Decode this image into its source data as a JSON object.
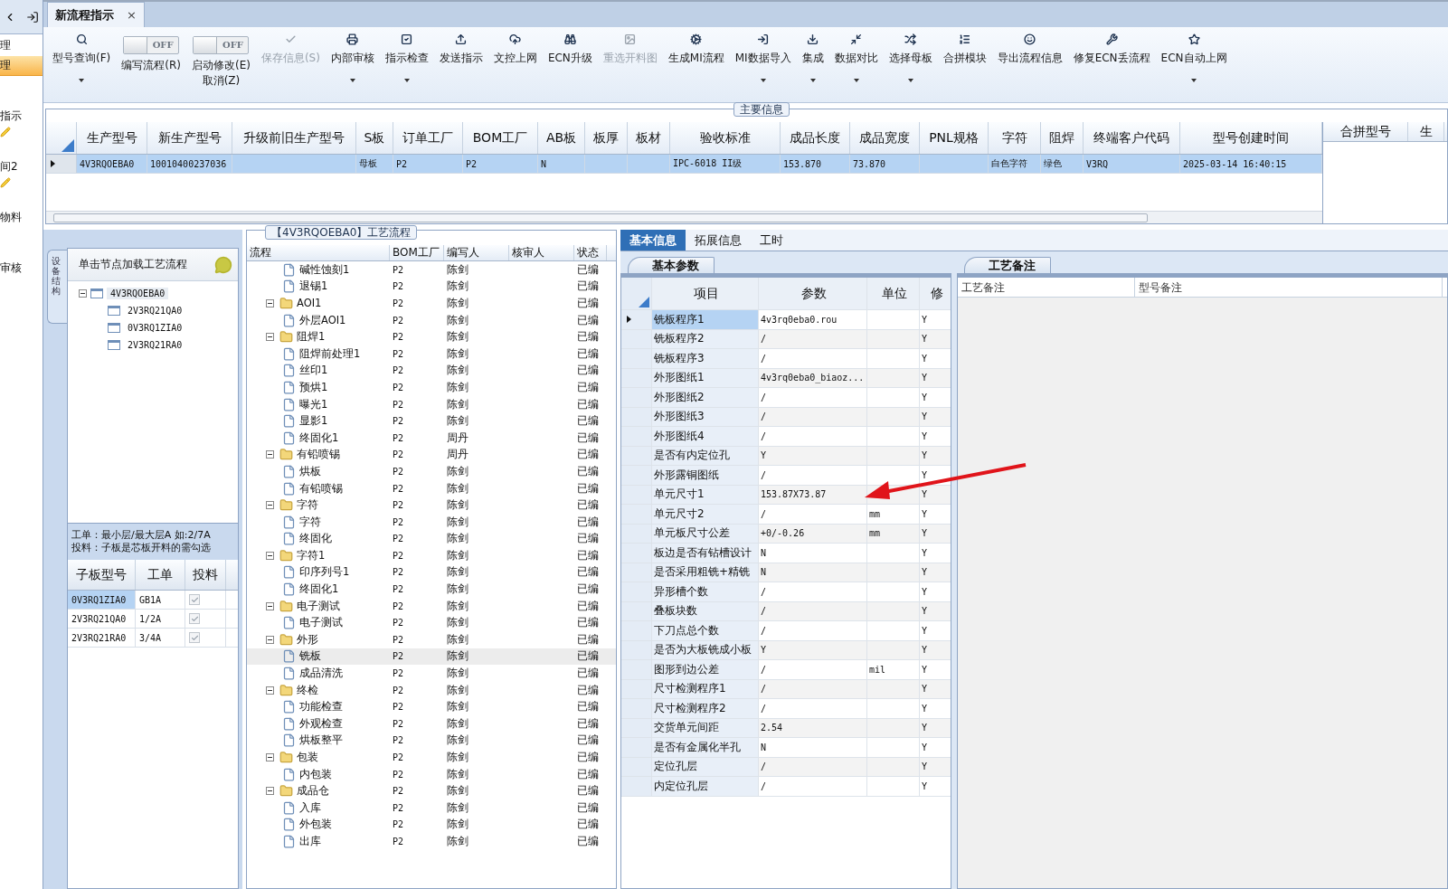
{
  "sidebar": {
    "items": [
      {
        "label": "理",
        "kind": "plain",
        "selected": false
      },
      {
        "label": "理",
        "kind": "plain",
        "selected": true
      },
      {
        "label": "指示",
        "kind": "plain",
        "selected": false
      },
      {
        "label": "间2",
        "kind": "tool",
        "selected": false
      },
      {
        "label": "物料",
        "kind": "tool",
        "selected": false
      },
      {
        "label": "审核",
        "kind": "plain",
        "selected": false
      }
    ]
  },
  "document_tab": {
    "title": "新流程指示",
    "close": "×"
  },
  "toolbar": [
    {
      "kind": "button",
      "label": "型号查询(F)",
      "dropdown": true,
      "disabled": false
    },
    {
      "kind": "toggle",
      "label": "编写流程(R)",
      "switch_text": "OFF",
      "on": false
    },
    {
      "kind": "toggle",
      "label": "启动修改(E)",
      "sublabel": "取消(Z)",
      "switch_text": "OFF",
      "on": false
    },
    {
      "kind": "button",
      "label": "保存信息(S)",
      "dropdown": false,
      "disabled": true
    },
    {
      "kind": "button",
      "label": "内部审核",
      "dropdown": true,
      "disabled": false
    },
    {
      "kind": "button",
      "label": "指示检查",
      "dropdown": true,
      "disabled": false
    },
    {
      "kind": "button",
      "label": "发送指示",
      "dropdown": false,
      "disabled": false
    },
    {
      "kind": "button",
      "label": "文控上网",
      "dropdown": false,
      "disabled": false
    },
    {
      "kind": "button",
      "label": "ECN升级",
      "dropdown": false,
      "disabled": false
    },
    {
      "kind": "button",
      "label": "重选开料图",
      "dropdown": false,
      "disabled": true
    },
    {
      "kind": "button",
      "label": "生成MI流程",
      "dropdown": false,
      "disabled": false
    },
    {
      "kind": "button",
      "label": "MI数据导入",
      "dropdown": true,
      "disabled": false
    },
    {
      "kind": "button",
      "label": "集成",
      "dropdown": true,
      "disabled": false
    },
    {
      "kind": "button",
      "label": "数据对比",
      "dropdown": true,
      "disabled": false
    },
    {
      "kind": "button",
      "label": "选择母板",
      "dropdown": true,
      "disabled": false
    },
    {
      "kind": "button",
      "label": "合拼模块",
      "dropdown": false,
      "disabled": false
    },
    {
      "kind": "button",
      "label": "导出流程信息",
      "dropdown": false,
      "disabled": false
    },
    {
      "kind": "button",
      "label": "修复ECN丢流程",
      "dropdown": false,
      "disabled": false
    },
    {
      "kind": "button",
      "label": "ECN自动上网",
      "dropdown": true,
      "disabled": false
    }
  ],
  "main_info": {
    "title": "主要信息",
    "columns": [
      "生产型号",
      "新生产型号",
      "升级前旧生产型号",
      "S板",
      "订单工厂",
      "BOM工厂",
      "AB板",
      "板厚",
      "板材",
      "验收标准",
      "成品长度",
      "成品宽度",
      "PNL规格",
      "字符",
      "阻焊",
      "终端客户代码",
      "型号创建时间"
    ],
    "rows": [
      {
        "selected": true,
        "cells": [
          "4V3RQOEBA0",
          "10010400237036",
          null,
          "母板",
          "P2",
          "P2",
          "N",
          null,
          null,
          "IPC-6018 II级",
          "153.870",
          "73.870",
          null,
          "白色字符",
          "绿色",
          "V3RQ",
          "2025-03-14 16:40:15"
        ]
      }
    ],
    "side_columns": [
      "合拼型号",
      "生"
    ]
  },
  "structure_panel": {
    "vertical_tab": "设备结构",
    "header": "单击节点加载工艺流程",
    "tree": [
      {
        "label": "4V3RQOEBA0",
        "selected": true,
        "expanded": true,
        "children": [
          {
            "label": "2V3RQ21QA0",
            "selected": false
          },
          {
            "label": "0V3RQ1ZIA0",
            "selected": false
          },
          {
            "label": "2V3RQ21RA0",
            "selected": false
          }
        ]
      }
    ],
    "notes": [
      "工单：最小层/最大层A 如:2/7A",
      "投料：子板是芯板开料的需勾选"
    ],
    "columns": [
      "子板型号",
      "工单",
      "投料"
    ],
    "rows": [
      {
        "board": "0V3RQ1ZIA0",
        "order": "GB1A",
        "checked": true,
        "selected": true
      },
      {
        "board": "2V3RQ21QA0",
        "order": "1/2A",
        "checked": true,
        "selected": false
      },
      {
        "board": "2V3RQ21RA0",
        "order": "3/4A",
        "checked": true,
        "selected": false
      }
    ]
  },
  "process_panel": {
    "title": "【4V3RQOEBA0】工艺流程",
    "columns": [
      "流程",
      "BOM工厂",
      "编写人",
      "核审人",
      "状态"
    ],
    "rows": [
      {
        "kind": "step",
        "label": "碱性蚀刻1",
        "bom": "P2",
        "writer": "陈剑",
        "status": "已编",
        "selected": false
      },
      {
        "kind": "step",
        "label": "退锡1",
        "bom": "P2",
        "writer": "陈剑",
        "status": "已编",
        "selected": false
      },
      {
        "kind": "group",
        "label": "AOI1",
        "bom": "P2",
        "writer": "陈剑",
        "status": "已编",
        "selected": false,
        "expanded": true,
        "children": [
          {
            "kind": "step",
            "label": "外层AOI1",
            "bom": "P2",
            "writer": "陈剑",
            "status": "已编",
            "selected": false
          }
        ]
      },
      {
        "kind": "group",
        "label": "阻焊1",
        "bom": "P2",
        "writer": "陈剑",
        "status": "已编",
        "selected": false,
        "expanded": true,
        "children": [
          {
            "kind": "step",
            "label": "阻焊前处理1",
            "bom": "P2",
            "writer": "陈剑",
            "status": "已编",
            "selected": false
          },
          {
            "kind": "step",
            "label": "丝印1",
            "bom": "P2",
            "writer": "陈剑",
            "status": "已编",
            "selected": false
          },
          {
            "kind": "step",
            "label": "预烘1",
            "bom": "P2",
            "writer": "陈剑",
            "status": "已编",
            "selected": false
          },
          {
            "kind": "step",
            "label": "曝光1",
            "bom": "P2",
            "writer": "陈剑",
            "status": "已编",
            "selected": false
          },
          {
            "kind": "step",
            "label": "显影1",
            "bom": "P2",
            "writer": "陈剑",
            "status": "已编",
            "selected": false
          },
          {
            "kind": "step",
            "label": "终固化1",
            "bom": "P2",
            "writer": "周丹",
            "status": "已编",
            "selected": false
          }
        ]
      },
      {
        "kind": "group",
        "label": "有铅喷锡",
        "bom": "P2",
        "writer": "周丹",
        "status": "已编",
        "selected": false,
        "expanded": true,
        "children": [
          {
            "kind": "step",
            "label": "烘板",
            "bom": "P2",
            "writer": "陈剑",
            "status": "已编",
            "selected": false
          },
          {
            "kind": "step",
            "label": "有铅喷锡",
            "bom": "P2",
            "writer": "陈剑",
            "status": "已编",
            "selected": false
          }
        ]
      },
      {
        "kind": "group",
        "label": "字符",
        "bom": "P2",
        "writer": "陈剑",
        "status": "已编",
        "selected": false,
        "expanded": true,
        "children": [
          {
            "kind": "step",
            "label": "字符",
            "bom": "P2",
            "writer": "陈剑",
            "status": "已编",
            "selected": false
          },
          {
            "kind": "step",
            "label": "终固化",
            "bom": "P2",
            "writer": "陈剑",
            "status": "已编",
            "selected": false
          }
        ]
      },
      {
        "kind": "group",
        "label": "字符1",
        "bom": "P2",
        "writer": "陈剑",
        "status": "已编",
        "selected": false,
        "expanded": true,
        "children": [
          {
            "kind": "step",
            "label": "印序列号1",
            "bom": "P2",
            "writer": "陈剑",
            "status": "已编",
            "selected": false
          },
          {
            "kind": "step",
            "label": "终固化1",
            "bom": "P2",
            "writer": "陈剑",
            "status": "已编",
            "selected": false
          }
        ]
      },
      {
        "kind": "group",
        "label": "电子测试",
        "bom": "P2",
        "writer": "陈剑",
        "status": "已编",
        "selected": false,
        "expanded": true,
        "children": [
          {
            "kind": "step",
            "label": "电子测试",
            "bom": "P2",
            "writer": "陈剑",
            "status": "已编",
            "selected": false
          }
        ]
      },
      {
        "kind": "group",
        "label": "外形",
        "bom": "P2",
        "writer": "陈剑",
        "status": "已编",
        "selected": false,
        "expanded": true,
        "children": [
          {
            "kind": "step",
            "label": "铣板",
            "bom": "P2",
            "writer": "陈剑",
            "status": "已编",
            "selected": true
          },
          {
            "kind": "step",
            "label": "成品清洗",
            "bom": "P2",
            "writer": "陈剑",
            "status": "已编",
            "selected": false
          }
        ]
      },
      {
        "kind": "group",
        "label": "终检",
        "bom": "P2",
        "writer": "陈剑",
        "status": "已编",
        "selected": false,
        "expanded": true,
        "children": [
          {
            "kind": "step",
            "label": "功能检查",
            "bom": "P2",
            "writer": "陈剑",
            "status": "已编",
            "selected": false
          },
          {
            "kind": "step",
            "label": "外观检查",
            "bom": "P2",
            "writer": "陈剑",
            "status": "已编",
            "selected": false
          },
          {
            "kind": "step",
            "label": "烘板整平",
            "bom": "P2",
            "writer": "陈剑",
            "status": "已编",
            "selected": false
          }
        ]
      },
      {
        "kind": "group",
        "label": "包装",
        "bom": "P2",
        "writer": "陈剑",
        "status": "已编",
        "selected": false,
        "expanded": true,
        "children": [
          {
            "kind": "step",
            "label": "内包装",
            "bom": "P2",
            "writer": "陈剑",
            "status": "已编",
            "selected": false
          }
        ]
      },
      {
        "kind": "group",
        "label": "成品仓",
        "bom": "P2",
        "writer": "陈剑",
        "status": "已编",
        "selected": false,
        "expanded": true,
        "children": [
          {
            "kind": "step",
            "label": "入库",
            "bom": "P2",
            "writer": "陈剑",
            "status": "已编",
            "selected": false
          },
          {
            "kind": "step",
            "label": "外包装",
            "bom": "P2",
            "writer": "陈剑",
            "status": "已编",
            "selected": false
          },
          {
            "kind": "step",
            "label": "出库",
            "bom": "P2",
            "writer": "陈剑",
            "status": "已编",
            "selected": false
          }
        ]
      }
    ]
  },
  "detail_tabs": [
    {
      "label": "基本信息",
      "selected": true
    },
    {
      "label": "拓展信息",
      "selected": false
    },
    {
      "label": "工时",
      "selected": false
    }
  ],
  "params_panel": {
    "tab": "基本参数",
    "columns": [
      "项目",
      "参数",
      "单位",
      "修"
    ],
    "rows": [
      {
        "item": "铣板程序1",
        "value": "4v3rq0eba0.rou",
        "unit": null,
        "modified": "Y",
        "selected": true
      },
      {
        "item": "铣板程序2",
        "value": "/",
        "unit": null,
        "modified": "Y",
        "selected": false
      },
      {
        "item": "铣板程序3",
        "value": "/",
        "unit": null,
        "modified": "Y",
        "selected": false
      },
      {
        "item": "外形图纸1",
        "value": "4v3rq0eba0_biaoz...",
        "unit": null,
        "modified": "Y",
        "selected": false
      },
      {
        "item": "外形图纸2",
        "value": "/",
        "unit": null,
        "modified": "Y",
        "selected": false
      },
      {
        "item": "外形图纸3",
        "value": "/",
        "unit": null,
        "modified": "Y",
        "selected": false
      },
      {
        "item": "外形图纸4",
        "value": "/",
        "unit": null,
        "modified": "Y",
        "selected": false
      },
      {
        "item": "是否有内定位孔",
        "value": "Y",
        "unit": null,
        "modified": "Y",
        "selected": false
      },
      {
        "item": "外形露铜图纸",
        "value": "/",
        "unit": null,
        "modified": "Y",
        "selected": false
      },
      {
        "item": "单元尺寸1",
        "value": "153.87X73.87",
        "unit": null,
        "modified": "Y",
        "selected": false
      },
      {
        "item": "单元尺寸2",
        "value": "/",
        "unit": "mm",
        "modified": "Y",
        "selected": false
      },
      {
        "item": "单元板尺寸公差",
        "value": "+0/-0.26",
        "unit": "mm",
        "modified": "Y",
        "selected": false
      },
      {
        "item": "板边是否有钻槽设计",
        "value": "N",
        "unit": null,
        "modified": "Y",
        "selected": false
      },
      {
        "item": "是否采用粗铣+精铣",
        "value": "N",
        "unit": null,
        "modified": "Y",
        "selected": false
      },
      {
        "item": "异形槽个数",
        "value": "/",
        "unit": null,
        "modified": "Y",
        "selected": false
      },
      {
        "item": "叠板块数",
        "value": "/",
        "unit": null,
        "modified": "Y",
        "selected": false
      },
      {
        "item": "下刀点总个数",
        "value": "/",
        "unit": null,
        "modified": "Y",
        "selected": false
      },
      {
        "item": "是否为大板铣成小板",
        "value": "Y",
        "unit": null,
        "modified": "Y",
        "selected": false
      },
      {
        "item": "图形到边公差",
        "value": "/",
        "unit": "mil",
        "modified": "Y",
        "selected": false
      },
      {
        "item": "尺寸检测程序1",
        "value": "/",
        "unit": null,
        "modified": "Y",
        "selected": false
      },
      {
        "item": "尺寸检测程序2",
        "value": "/",
        "unit": null,
        "modified": "Y",
        "selected": false
      },
      {
        "item": "交货单元间距",
        "value": "2.54",
        "unit": null,
        "modified": "Y",
        "selected": false
      },
      {
        "item": "是否有金属化半孔",
        "value": "N",
        "unit": null,
        "modified": "Y",
        "selected": false
      },
      {
        "item": "定位孔层",
        "value": "/",
        "unit": null,
        "modified": "Y",
        "selected": false
      },
      {
        "item": "内定位孔层",
        "value": "/",
        "unit": null,
        "modified": "Y",
        "selected": false
      }
    ]
  },
  "remarks_panel": {
    "tab": "工艺备注",
    "columns": [
      "工艺备注",
      "型号备注"
    ]
  }
}
